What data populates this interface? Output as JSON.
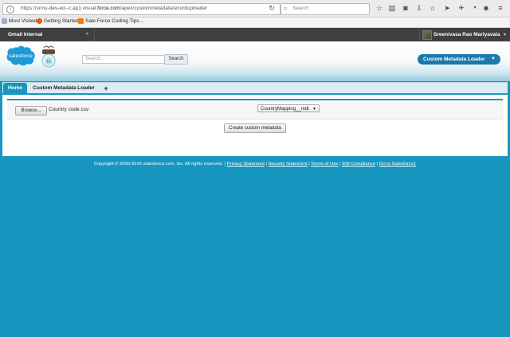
{
  "browser": {
    "url_prefix": "https://srinu-dev-ed--c.ap1.visual.",
    "url_domain": "force.com",
    "url_suffix": "/apex/custommetadatarecorduploader",
    "search_placeholder": "Search",
    "bookmarks": [
      "Most Visited",
      "Getting Started",
      "Sale Force Coding Tips..."
    ]
  },
  "sf_topbar": {
    "app_label": "Gmail Internal",
    "user_name": "Sreenivasa Rao Mariyavala"
  },
  "header": {
    "logo_text": "salesforce",
    "mascot_badge": "16",
    "search_placeholder": "Search...",
    "search_button": "Search",
    "app_switcher": "Custom Metadata Loader"
  },
  "tabs": [
    {
      "label": "Home"
    },
    {
      "label": "Custom Metadata Loader"
    },
    {
      "label": "+"
    }
  ],
  "form": {
    "browse_label": "Browse...",
    "file_name": "Country code.csv",
    "type_selected": "CountryMapping__mdt",
    "create_label": "Create custom metadata"
  },
  "footer": {
    "copyright": "Copyright © 2000-2016 salesforce.com, inc. All rights reserved. |",
    "links": [
      "Privacy Statement",
      "Security Statement",
      "Terms of Use",
      "508 Compliance",
      "Go to Salesforce1"
    ]
  },
  "colors": {
    "accent": "#1797c0",
    "topbar": "#3f3f3f",
    "switcher": "#1a79ae"
  }
}
